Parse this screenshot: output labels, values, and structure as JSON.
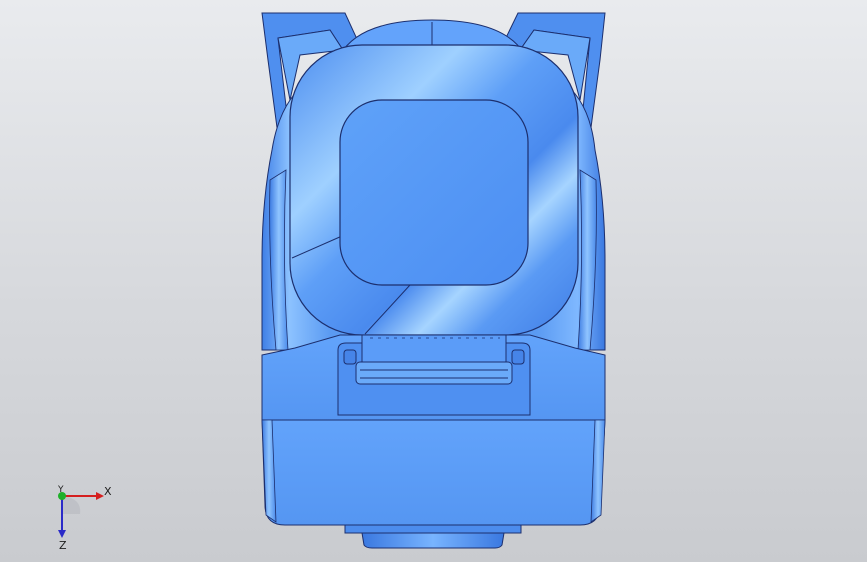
{
  "viewport": {
    "background_top": "#e9ebee",
    "background_bottom": "#c9cbcf",
    "model_color": "#5f9ef5",
    "edge_color": "#1c2f6e"
  },
  "triad": {
    "x_label": "X",
    "y_label": "Y",
    "z_label": "Z",
    "x_color": "#d51f1f",
    "y_color": "#1fb02a",
    "z_color": "#2a2ac8"
  }
}
